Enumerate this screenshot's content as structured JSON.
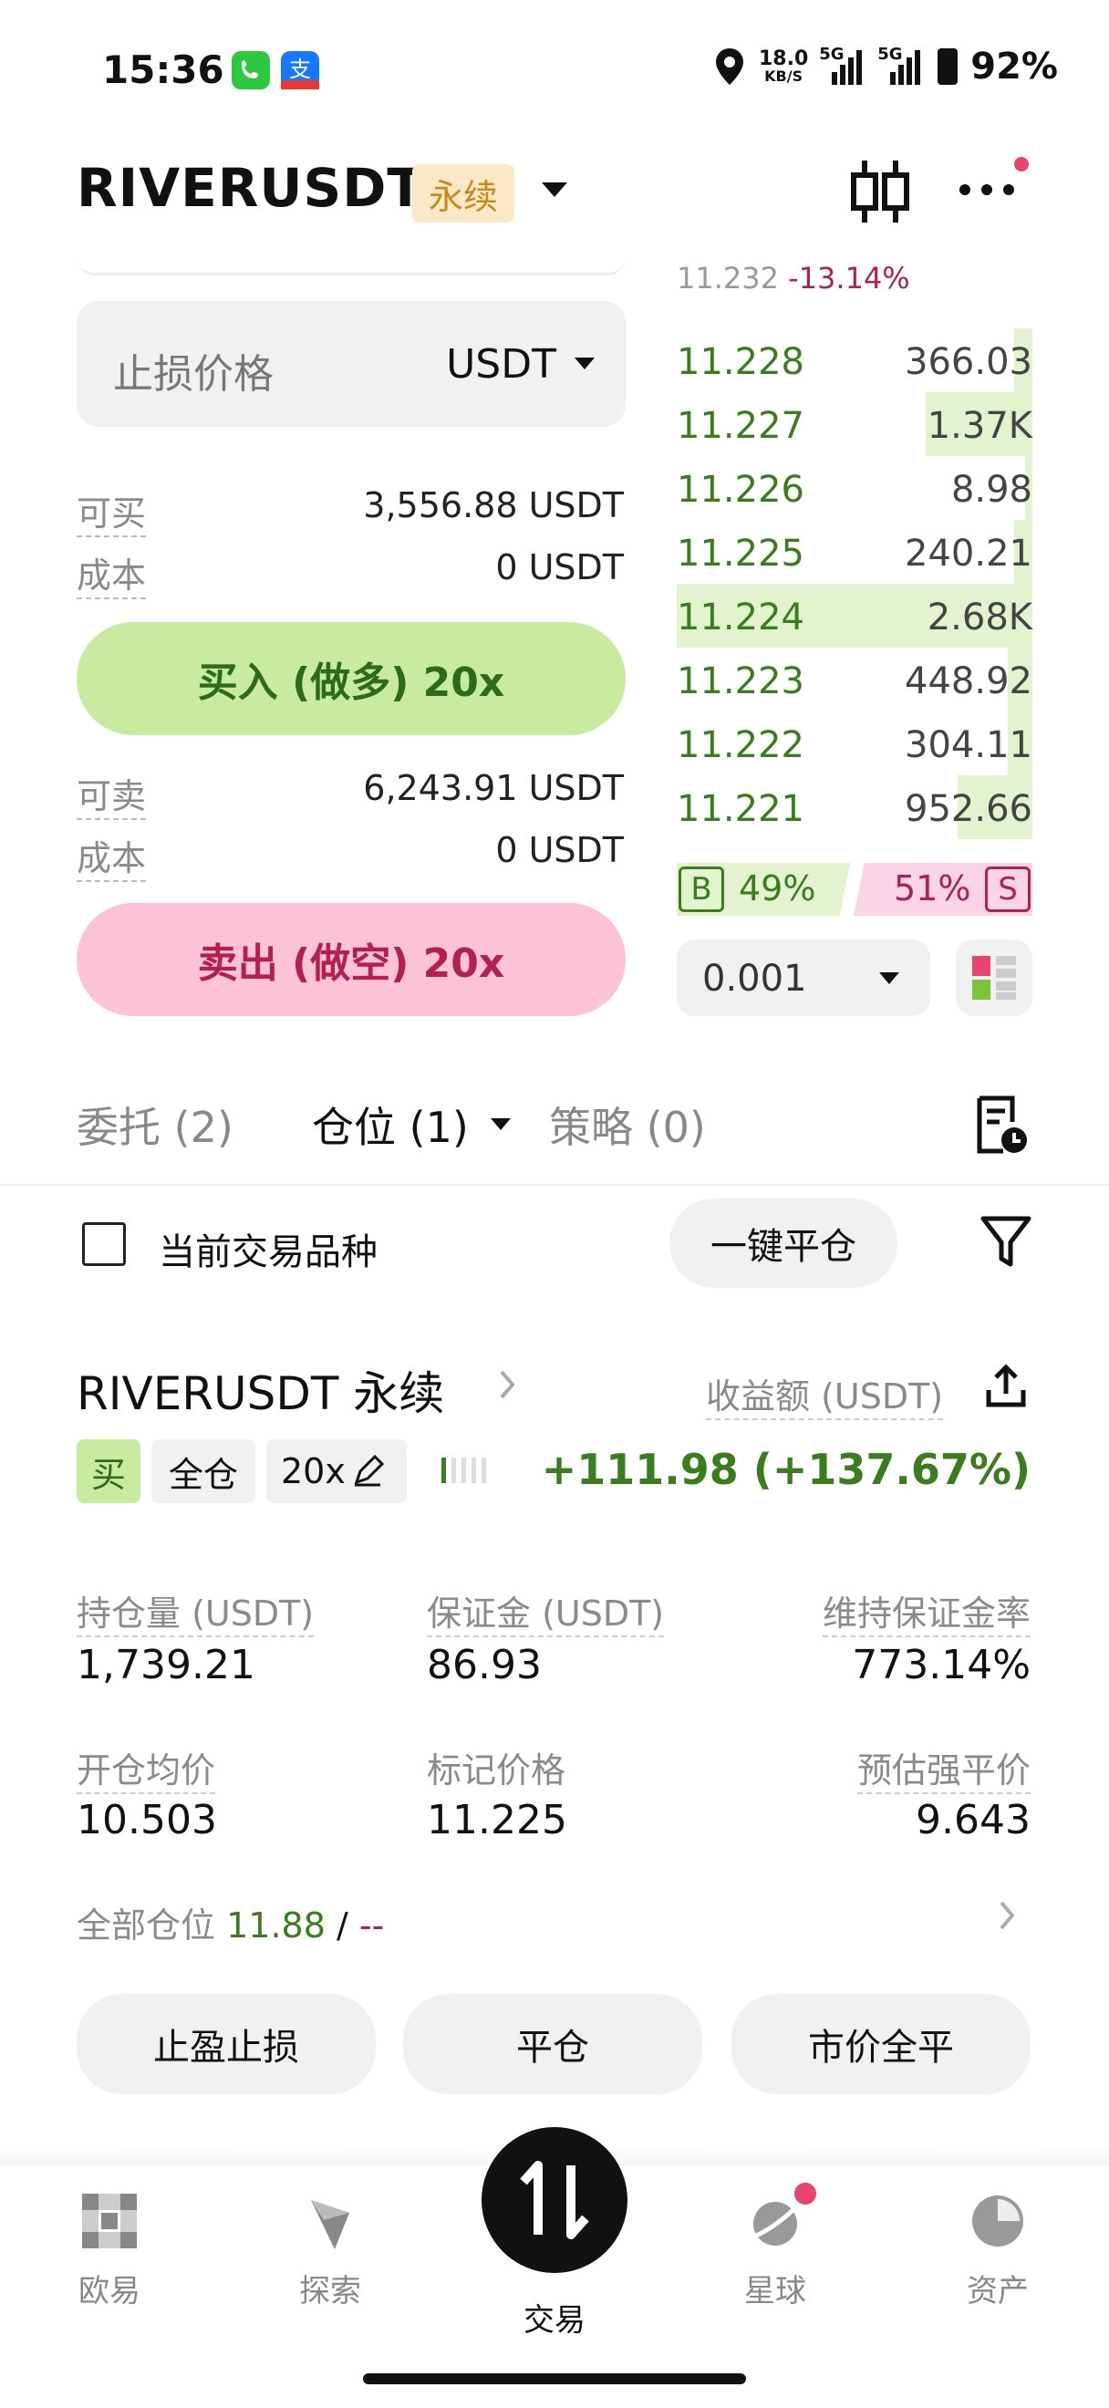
{
  "status_bar": {
    "time": "15:36",
    "speed_value": "18.0",
    "speed_unit": "KB/S",
    "net1": "5G",
    "net2": "5G",
    "battery": "92%"
  },
  "header": {
    "symbol": "RIVERUSDT",
    "contract_type": "永续"
  },
  "order_form": {
    "stop_loss_label": "止损价格",
    "stop_loss_unit": "USDT",
    "buy_avail_label": "可买",
    "buy_avail_value": "3,556.88 USDT",
    "buy_cost_label": "成本",
    "buy_cost_value": "0 USDT",
    "buy_button": "买入 (做多) 20x",
    "sell_avail_label": "可卖",
    "sell_avail_value": "6,243.91 USDT",
    "sell_cost_label": "成本",
    "sell_cost_value": "0 USDT",
    "sell_button": "卖出 (做空) 20x"
  },
  "order_book": {
    "last_price": "11.232",
    "change": "-13.14%",
    "rows": [
      {
        "price": "11.228",
        "qty": "366.03",
        "depth": 0.05
      },
      {
        "price": "11.227",
        "qty": "1.37K",
        "depth": 0.3
      },
      {
        "price": "11.226",
        "qty": "8.98",
        "depth": 0.02
      },
      {
        "price": "11.225",
        "qty": "240.21",
        "depth": 0.05
      },
      {
        "price": "11.224",
        "qty": "2.68K",
        "depth": 1.0
      },
      {
        "price": "11.223",
        "qty": "448.92",
        "depth": 0.07
      },
      {
        "price": "11.222",
        "qty": "304.11",
        "depth": 0.07
      },
      {
        "price": "11.221",
        "qty": "952.66",
        "depth": 0.21
      }
    ],
    "buy_label": "B",
    "buy_pct": "49%",
    "sell_pct": "51%",
    "sell_label": "S",
    "precision": "0.001"
  },
  "tabs": {
    "orders": "委托 (2)",
    "positions": "仓位 (1)",
    "strategies": "策略 (0)"
  },
  "filter": {
    "current_symbol": "当前交易品种",
    "close_all": "一键平仓"
  },
  "position": {
    "title": "RIVERUSDT 永续",
    "pnl_label": "收益额 (USDT)",
    "side": "买",
    "margin_mode": "全仓",
    "leverage": "20x",
    "pnl_value": "+111.98 (+137.67%)",
    "size_label": "持仓量 (USDT)",
    "size_value": "1,739.21",
    "margin_label": "保证金 (USDT)",
    "margin_value": "86.93",
    "mmr_label": "维持保证金率",
    "mmr_value": "773.14%",
    "entry_label": "开仓均价",
    "entry_value": "10.503",
    "mark_label": "标记价格",
    "mark_value": "11.225",
    "liq_label": "预估强平价",
    "liq_value": "9.643",
    "all_pos_label": "全部仓位",
    "all_pos_value": "11.88",
    "all_pos_sep": "/",
    "all_pos_other": "--",
    "tp_sl_button": "止盈止损",
    "close_button": "平仓",
    "market_close_button": "市价全平"
  },
  "bottom_nav": {
    "okx": "欧易",
    "explore": "探索",
    "trade": "交易",
    "planet": "星球",
    "assets": "资产"
  },
  "colors": {
    "green": "#3a7d1e",
    "red": "#b3204e",
    "buy_bg": "#c9eba0",
    "sell_bg": "#fbc2d8",
    "perp_tag": "#c78a1e"
  }
}
